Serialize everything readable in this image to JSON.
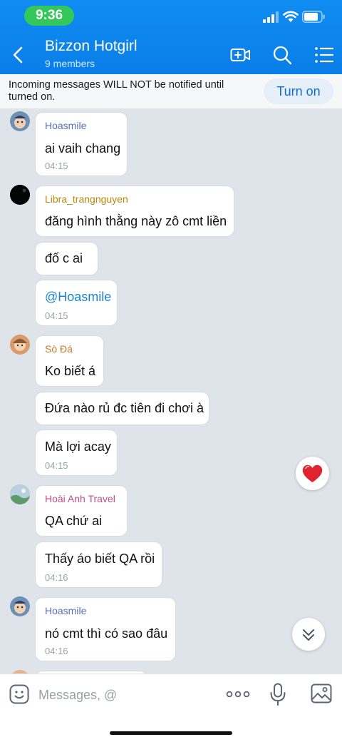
{
  "status_bar": {
    "time": "9:36"
  },
  "header": {
    "title": "Bizzon Hotgirl",
    "subtitle": "9 members"
  },
  "notify": {
    "text": "Incoming messages WILL NOT be notified until turned on.",
    "button": "Turn on"
  },
  "messages": [
    {
      "sender": "Hoasmile",
      "sender_color": "#5b6fb8",
      "text": "ai vaih chang",
      "time": "04:15"
    },
    {
      "sender": "Libra_trangnguyen",
      "sender_color": "#b8860b",
      "text": "đăng hình thằng này zô cmt liền",
      "time": ""
    },
    {
      "sender": "",
      "text": "đố c ai",
      "time": ""
    },
    {
      "sender": "",
      "text": "@Hoasmile",
      "time": "04:15"
    },
    {
      "sender": "Sò Đá",
      "sender_color": "#c4792b",
      "text": "Ko biết á",
      "time": ""
    },
    {
      "sender": "",
      "text": "Đứa nào rủ đc tiên đi chơi à",
      "time": ""
    },
    {
      "sender": "",
      "text": "Mà lợi acay",
      "time": "04:15"
    },
    {
      "sender": "Hoài Anh Travel",
      "sender_color": "#c2507e",
      "text": "QA chứ ai",
      "time": ""
    },
    {
      "sender": "",
      "text": "Thấy áo biết QA rồi",
      "time": "04:16"
    },
    {
      "sender": "Hoasmile",
      "sender_color": "#5b6fb8",
      "text": "nó cmt thì có sao đâu",
      "time": "04:16"
    }
  ],
  "input": {
    "placeholder": "Messages, @"
  },
  "colors": {
    "header_blue": "#0a7ee8",
    "mention_blue": "#1a84d6",
    "status_green": "#34c759"
  },
  "icons": {
    "back": "chevron-left-icon",
    "video_add": "video-plus-icon",
    "search": "search-icon",
    "menu": "list-menu-icon",
    "heart": "heart-icon",
    "scroll_down": "double-chevron-down-icon",
    "emoji": "emoji-icon",
    "more": "more-dots-icon",
    "mic": "microphone-icon",
    "image": "image-icon"
  }
}
